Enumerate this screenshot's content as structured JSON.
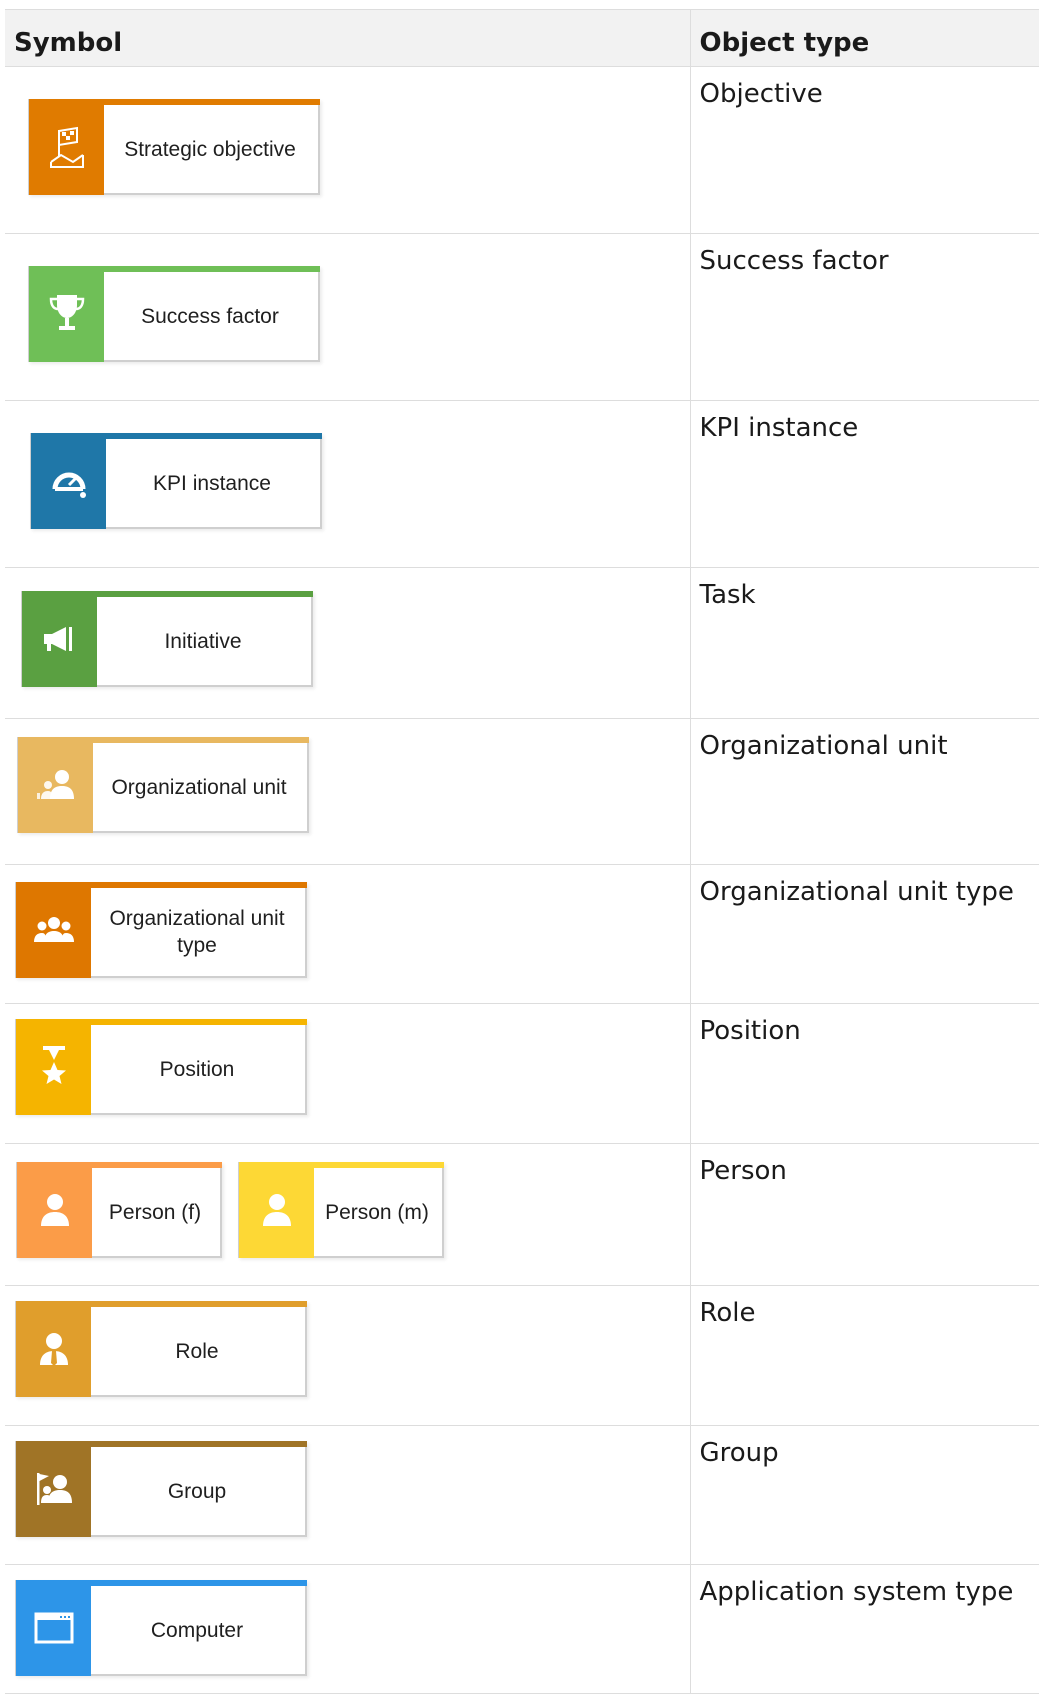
{
  "header": {
    "symbol": "Symbol",
    "object_type": "Object type"
  },
  "rows": [
    {
      "object_type": "Objective",
      "shapes": [
        {
          "label": "Strategic objective",
          "icon": "flag-map-icon",
          "color": "#e07b00"
        }
      ]
    },
    {
      "object_type": "Success factor",
      "shapes": [
        {
          "label": "Success factor",
          "icon": "trophy-icon",
          "color": "#6fbf57"
        }
      ]
    },
    {
      "object_type": "KPI instance",
      "shapes": [
        {
          "label": "KPI instance",
          "icon": "gauge-icon",
          "color": "#1f77a8"
        }
      ]
    },
    {
      "object_type": "Task",
      "shapes": [
        {
          "label": "Initiative",
          "icon": "megaphone-icon",
          "color": "#5aa041"
        }
      ]
    },
    {
      "object_type": "Organizational unit",
      "shapes": [
        {
          "label": "Organizational unit",
          "icon": "org-unit-icon",
          "color": "#e8b860"
        }
      ]
    },
    {
      "object_type": "Organizational unit type",
      "shapes": [
        {
          "label": "Organizational unit type",
          "icon": "people-group-icon",
          "color": "#de7700"
        }
      ]
    },
    {
      "object_type": "Position",
      "shapes": [
        {
          "label": "Position",
          "icon": "star-position-icon",
          "color": "#f5b400"
        }
      ]
    },
    {
      "object_type": "Person",
      "shapes": [
        {
          "label": "Person (f)",
          "icon": "person-icon",
          "color": "#fb9c48"
        },
        {
          "label": "Person (m)",
          "icon": "person-icon",
          "color": "#fdd835"
        }
      ]
    },
    {
      "object_type": "Role",
      "shapes": [
        {
          "label": "Role",
          "icon": "role-person-icon",
          "color": "#e09e2c"
        }
      ]
    },
    {
      "object_type": "Group",
      "shapes": [
        {
          "label": "Group",
          "icon": "group-flag-icon",
          "color": "#a07426"
        }
      ]
    },
    {
      "object_type": "Application system type",
      "shapes": [
        {
          "label": "Computer",
          "icon": "window-icon",
          "color": "#2d95e8"
        }
      ]
    }
  ]
}
